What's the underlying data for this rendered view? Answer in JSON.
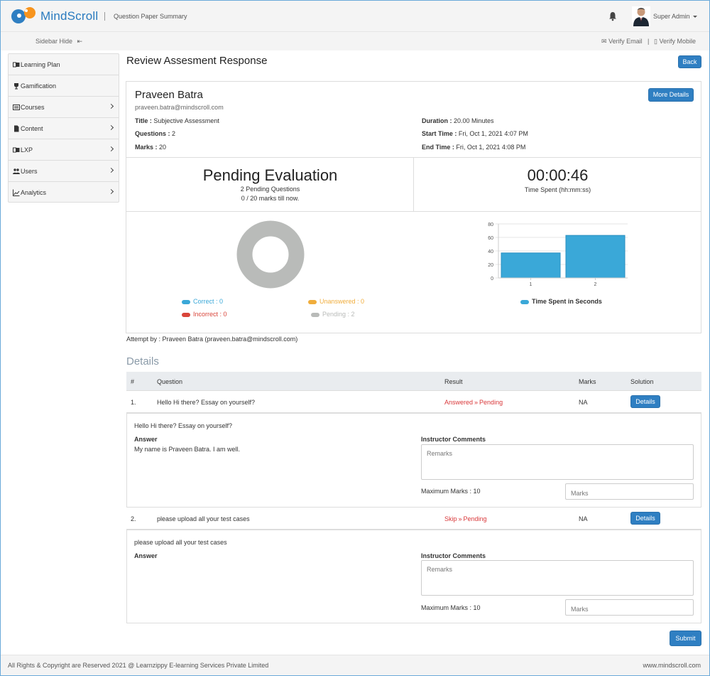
{
  "header": {
    "brand": "MindScroll",
    "page_title": "Question Paper Summary",
    "user_name": "Super Admin"
  },
  "subbar": {
    "sidebar_hide": "Sidebar Hide",
    "verify_email": "Verify Email",
    "divider": "|",
    "verify_mobile": "Verify Mobile"
  },
  "sidebar": {
    "items": [
      {
        "label": "Learning Plan",
        "icon": "book-icon",
        "has_arrow": false
      },
      {
        "label": "Gamification",
        "icon": "trophy-icon",
        "has_arrow": false
      },
      {
        "label": "Courses",
        "icon": "courses-icon",
        "has_arrow": true
      },
      {
        "label": "Content",
        "icon": "file-icon",
        "has_arrow": true
      },
      {
        "label": "LXP",
        "icon": "book-icon",
        "has_arrow": true
      },
      {
        "label": "Users",
        "icon": "users-icon",
        "has_arrow": true
      },
      {
        "label": "Analytics",
        "icon": "chart-icon",
        "has_arrow": true
      }
    ]
  },
  "main": {
    "title": "Review Assesment Response",
    "back_label": "Back",
    "more_details_label": "More Details"
  },
  "candidate": {
    "name": "Praveen Batra",
    "email": "praveen.batra@mindscroll.com",
    "title_label": "Title :",
    "title_value": "Subjective Assessment",
    "questions_label": "Questions :",
    "questions_value": "2",
    "marks_label": "Marks :",
    "marks_value": "20",
    "duration_label": "Duration :",
    "duration_value": "20.00 Minutes",
    "start_label": "Start Time :",
    "start_value": "Fri, Oct 1, 2021 4:07 PM",
    "end_label": "End Time :",
    "end_value": "Fri, Oct 1, 2021 4:08 PM"
  },
  "summary": {
    "status": "Pending Evaluation",
    "pending_questions": "2 Pending Questions",
    "marks_till_now": "0 / 20 marks till now.",
    "time_spent": "00:00:46",
    "time_spent_label": "Time Spent (hh:mm:ss)"
  },
  "chart_data": [
    {
      "type": "pie",
      "categories": [
        "Correct",
        "Unanswered",
        "Incorrect",
        "Pending"
      ],
      "values": [
        0,
        0,
        0,
        2
      ],
      "legend_labels": [
        "Correct : 0",
        "Unanswered : 0",
        "Incorrect : 0",
        "Pending : 2"
      ],
      "colors": [
        "#3aa8d8",
        "#f0ad3c",
        "#d9453a",
        "#b9bbb9"
      ],
      "legend": "bottom"
    },
    {
      "type": "bar",
      "categories": [
        "1",
        "2"
      ],
      "series": [
        {
          "name": "Time Spent in Seconds",
          "values": [
            37,
            63
          ]
        }
      ],
      "y_ticks": [
        "0",
        "20",
        "40",
        "60",
        "80"
      ],
      "ylim": [
        0,
        80
      ],
      "color": "#3aa8d8",
      "grid": true,
      "legend": "bottom"
    }
  ],
  "attempt": "Attempt by : Praveen Batra (praveen.batra@mindscroll.com)",
  "details": {
    "heading": "Details",
    "columns": [
      "#",
      "Question",
      "Result",
      "Marks",
      "Solution"
    ],
    "rows": [
      {
        "num": "1.",
        "question": "Hello Hi there? Essay on yourself?",
        "result_status": "Answered",
        "result_arrow": "»",
        "result_eval": "Pending",
        "marks": "NA",
        "solution_label": "Details",
        "answer_label": "Answer",
        "answer": "My name is Praveen Batra. I am well.",
        "comments_label": "Instructor Comments",
        "remarks_placeholder": "Remarks",
        "max_marks": "Maximum Marks : 10",
        "marks_placeholder": "Marks"
      },
      {
        "num": "2.",
        "question": "please upload all your test cases",
        "result_status": "Skip",
        "result_arrow": "»",
        "result_eval": "Pending",
        "marks": "NA",
        "solution_label": "Details",
        "answer_label": "Answer",
        "answer": "",
        "comments_label": "Instructor Comments",
        "remarks_placeholder": "Remarks",
        "max_marks": "Maximum Marks : 10",
        "marks_placeholder": "Marks"
      }
    ],
    "submit_label": "Submit"
  },
  "footer": {
    "copyright": "All Rights & Copyright are Reserved 2021 @ Learnzippy E-learning Services Private Limited",
    "site": "www.mindscroll.com"
  },
  "colors": {
    "brand_blue": "#2a7bbf",
    "button_blue": "#2f7fc2",
    "pending_red": "#d9383a",
    "chart_blue": "#3aa8d8"
  }
}
